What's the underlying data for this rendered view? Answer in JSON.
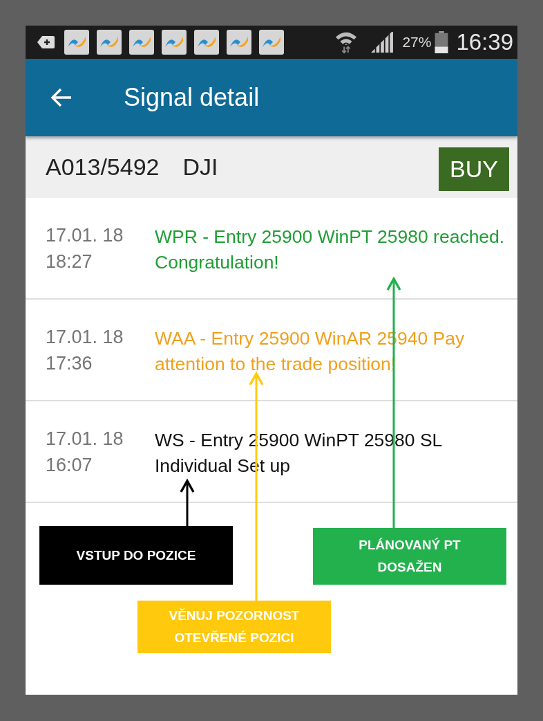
{
  "status_bar": {
    "battery": "27%",
    "time": "16:39"
  },
  "app_bar": {
    "title": "Signal detail"
  },
  "signal": {
    "code": "A013/5492",
    "symbol": "DJI",
    "action": "BUY"
  },
  "messages": [
    {
      "kind": "reached",
      "date": "17.01. 18",
      "time": "18:27",
      "text": "WPR - Entry 25900 WinPT 25980 reached. Congratulation!"
    },
    {
      "kind": "attention",
      "date": "17.01. 18",
      "time": "17:36",
      "text": "WAA - Entry 25900 WinAR 25940 Pay attention to the trade position!"
    },
    {
      "kind": "entry",
      "date": "17.01. 18",
      "time": "16:07",
      "text": "WS - Entry 25900 WinPT 25980 SL Individual Set up"
    }
  ],
  "callouts": [
    {
      "kind": "entry",
      "color": "#000000",
      "text": "VSTUP DO POZICE"
    },
    {
      "kind": "reached",
      "color": "#22b14c",
      "text": "PLÁNOVANÝ PT DOSAŽEN"
    },
    {
      "kind": "attention",
      "color": "#ffc90e",
      "text": "VĚNUJ POZORNOST OTEVŘENÉ POZICI"
    }
  ]
}
